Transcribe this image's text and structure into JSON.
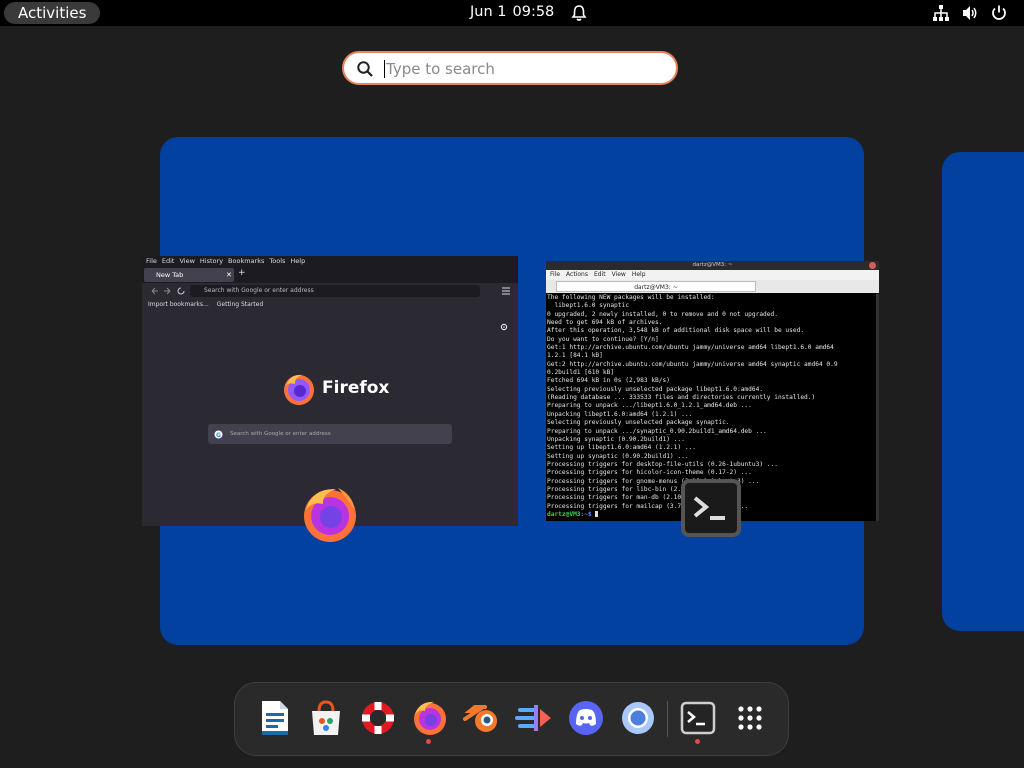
{
  "topbar": {
    "activities_label": "Activities",
    "date": "Jun 1",
    "time": "09:58",
    "icons": [
      "bell-icon",
      "network-icon",
      "volume-icon",
      "power-icon"
    ]
  },
  "search": {
    "placeholder": "Type to search",
    "value": ""
  },
  "firefox_window": {
    "menu": [
      "File",
      "Edit",
      "View",
      "History",
      "Bookmarks",
      "Tools",
      "Help"
    ],
    "tab_label": "New Tab",
    "urlbar_placeholder": "Search with Google or enter address",
    "bookmarks": [
      "Import bookmarks...",
      "Getting Started"
    ],
    "brand": "Firefox",
    "content_search_placeholder": "Search with Google or enter address"
  },
  "terminal_window": {
    "title": "dartz@VM3: ~",
    "menu": [
      "File",
      "Actions",
      "Edit",
      "View",
      "Help"
    ],
    "tab_label": "dartz@VM3: ~",
    "lines": [
      "The following NEW packages will be installed:",
      "  libept1.6.0 synaptic",
      "0 upgraded, 2 newly installed, 0 to remove and 0 not upgraded.",
      "Need to get 694 kB of archives.",
      "After this operation, 3,548 kB of additional disk space will be used.",
      "Do you want to continue? [Y/n]",
      "Get:1 http://archive.ubuntu.com/ubuntu jammy/universe amd64 libept1.6.0 amd64",
      "1.2.1 [84.1 kB]",
      "Get:2 http://archive.ubuntu.com/ubuntu jammy/universe amd64 synaptic amd64 0.9",
      "0.2build1 [610 kB]",
      "Fetched 694 kB in 0s (2,983 kB/s)",
      "Selecting previously unselected package libept1.6.0:amd64.",
      "(Reading database ... 333533 files and directories currently installed.)",
      "Preparing to unpack .../libept1.6.0_1.2.1_amd64.deb ...",
      "Unpacking libept1.6.0:amd64 (1.2.1) ...",
      "Selecting previously unselected package synaptic.",
      "Preparing to unpack .../synaptic_0.90.2build1_amd64.deb ...",
      "Unpacking synaptic (0.90.2build1) ...",
      "Setting up libept1.6.0:amd64 (1.2.1) ...",
      "Setting up synaptic (0.90.2build1) ...",
      "Processing triggers for desktop-file-utils (0.26-1ubuntu3) ...",
      "Processing triggers for hicolor-icon-theme (0.17-2) ...",
      "Processing triggers for gnome-menus (3.36.0-1ubuntu3) ...",
      "Processing triggers for libc-bin (2.35-0ubuntu3) ...",
      "Processing triggers for man-db (2.10.2-1) ...",
      "Processing triggers for mailcap (3.70+nmu1ubuntu1) ..."
    ],
    "prompt_user": "dartz@VM3",
    "prompt_path": ":~$"
  },
  "dock": {
    "apps": [
      {
        "name": "libreoffice-writer-icon"
      },
      {
        "name": "software-store-icon"
      },
      {
        "name": "help-icon"
      },
      {
        "name": "firefox-icon",
        "running": true
      },
      {
        "name": "blender-icon"
      },
      {
        "name": "dev-tool-icon"
      },
      {
        "name": "discord-icon"
      },
      {
        "name": "chromium-icon"
      },
      {
        "name": "terminal-icon",
        "running": true
      },
      {
        "name": "show-apps-icon"
      }
    ]
  },
  "colors": {
    "workspace": "#0241a0",
    "accent": "#e9835a",
    "running_dot": "#e5484d"
  }
}
